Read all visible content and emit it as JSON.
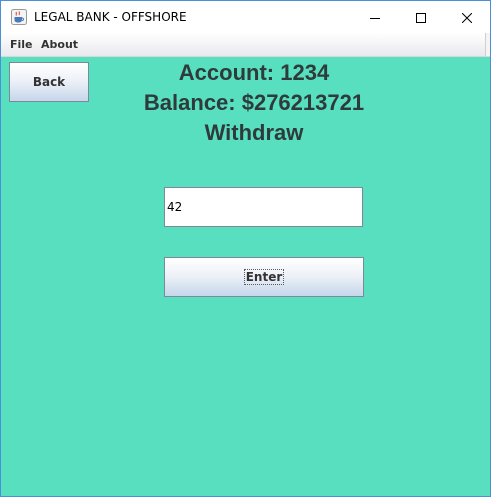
{
  "window": {
    "title": "LEGAL BANK - OFFSHORE",
    "icon": "java-cup-icon",
    "controls": [
      "minimize-icon",
      "maximize-icon",
      "close-icon"
    ]
  },
  "menubar": {
    "items": [
      {
        "label": "File"
      },
      {
        "label": "About"
      }
    ]
  },
  "content": {
    "background_color": "#57dfc0",
    "back_button_label": "Back",
    "account_line": "Account: 1234",
    "balance_line": "Balance: $276213721",
    "action_line": "Withdraw",
    "amount_input": {
      "value": "42",
      "placeholder": ""
    },
    "enter_button_label": "Enter"
  }
}
